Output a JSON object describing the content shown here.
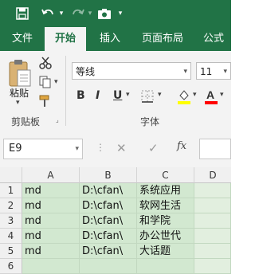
{
  "ribbon_tabs": [
    "文件",
    "开始",
    "插入",
    "页面布局",
    "公式"
  ],
  "clipboard": {
    "paste_label": "粘贴",
    "group_label": "剪贴板"
  },
  "font": {
    "name": "等线",
    "size": "11",
    "group_label": "字体",
    "bold": "B",
    "italic": "I",
    "underline": "U"
  },
  "formula_bar": {
    "name_box": "E9",
    "fx": "fx"
  },
  "grid": {
    "columns": [
      "A",
      "B",
      "C",
      "D"
    ],
    "rows": [
      "1",
      "2",
      "3",
      "4",
      "5",
      "6"
    ],
    "data": [
      [
        "md",
        "D:\\cfan\\",
        "系统应用"
      ],
      [
        "md",
        "D:\\cfan\\",
        "软网生活"
      ],
      [
        "md",
        "D:\\cfan\\",
        "和学院"
      ],
      [
        "md",
        "D:\\cfan\\",
        "办公世代"
      ],
      [
        "md",
        "D:\\cfan\\",
        "大话题"
      ]
    ]
  },
  "colors": {
    "excel_green": "#217346",
    "highlight_yellow": "#ffff00",
    "font_red": "#ff0000",
    "cell_green": "#d2e8d0"
  }
}
